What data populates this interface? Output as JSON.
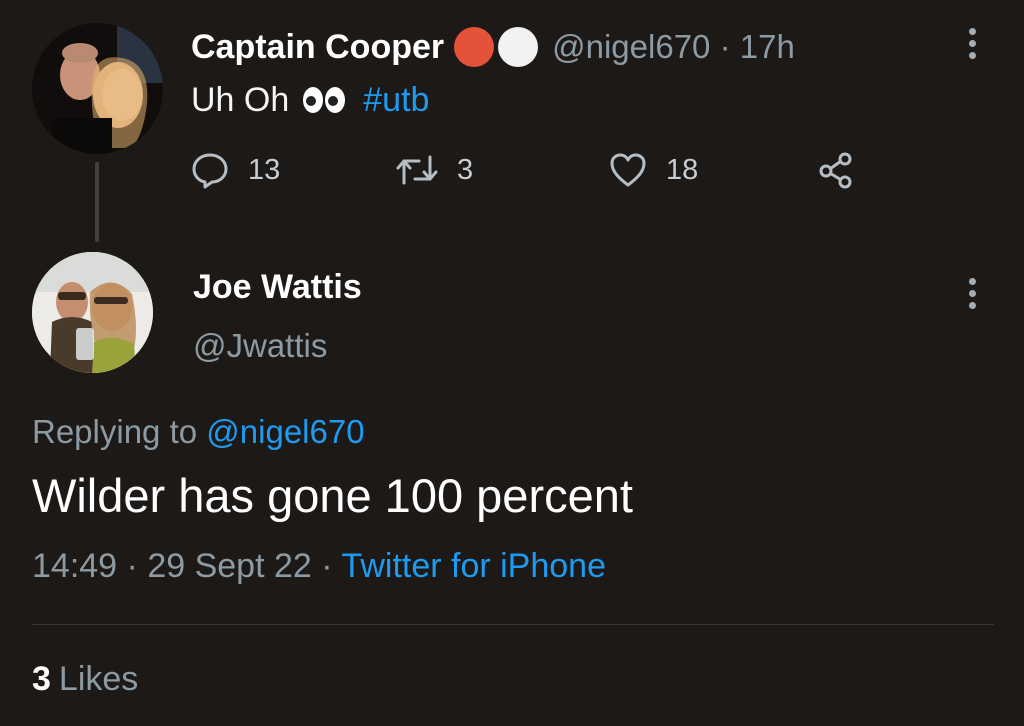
{
  "parent_tweet": {
    "display_name": "Captain Cooper",
    "badge_colors": [
      "#e5523a",
      "#f2f2f2"
    ],
    "handle": "@nigel670",
    "separator": "·",
    "time_ago": "17h",
    "text": "Uh Oh",
    "emoji": "eyes",
    "hashtag": "#utb",
    "actions": {
      "reply_count": "13",
      "retweet_count": "3",
      "like_count": "18"
    }
  },
  "reply_tweet": {
    "display_name": "Joe Wattis",
    "handle": "@Jwattis",
    "replying_prefix": "Replying to",
    "replying_to": "@nigel670",
    "text": "Wilder has gone 100 percent",
    "time": "14:49",
    "date": "29 Sept 22",
    "separator": "·",
    "source": "Twitter for iPhone",
    "likes_count": "3",
    "likes_label": "Likes"
  },
  "colors": {
    "background": "#1d1917",
    "link": "#1d9bf0",
    "muted": "#8c9aa4"
  }
}
